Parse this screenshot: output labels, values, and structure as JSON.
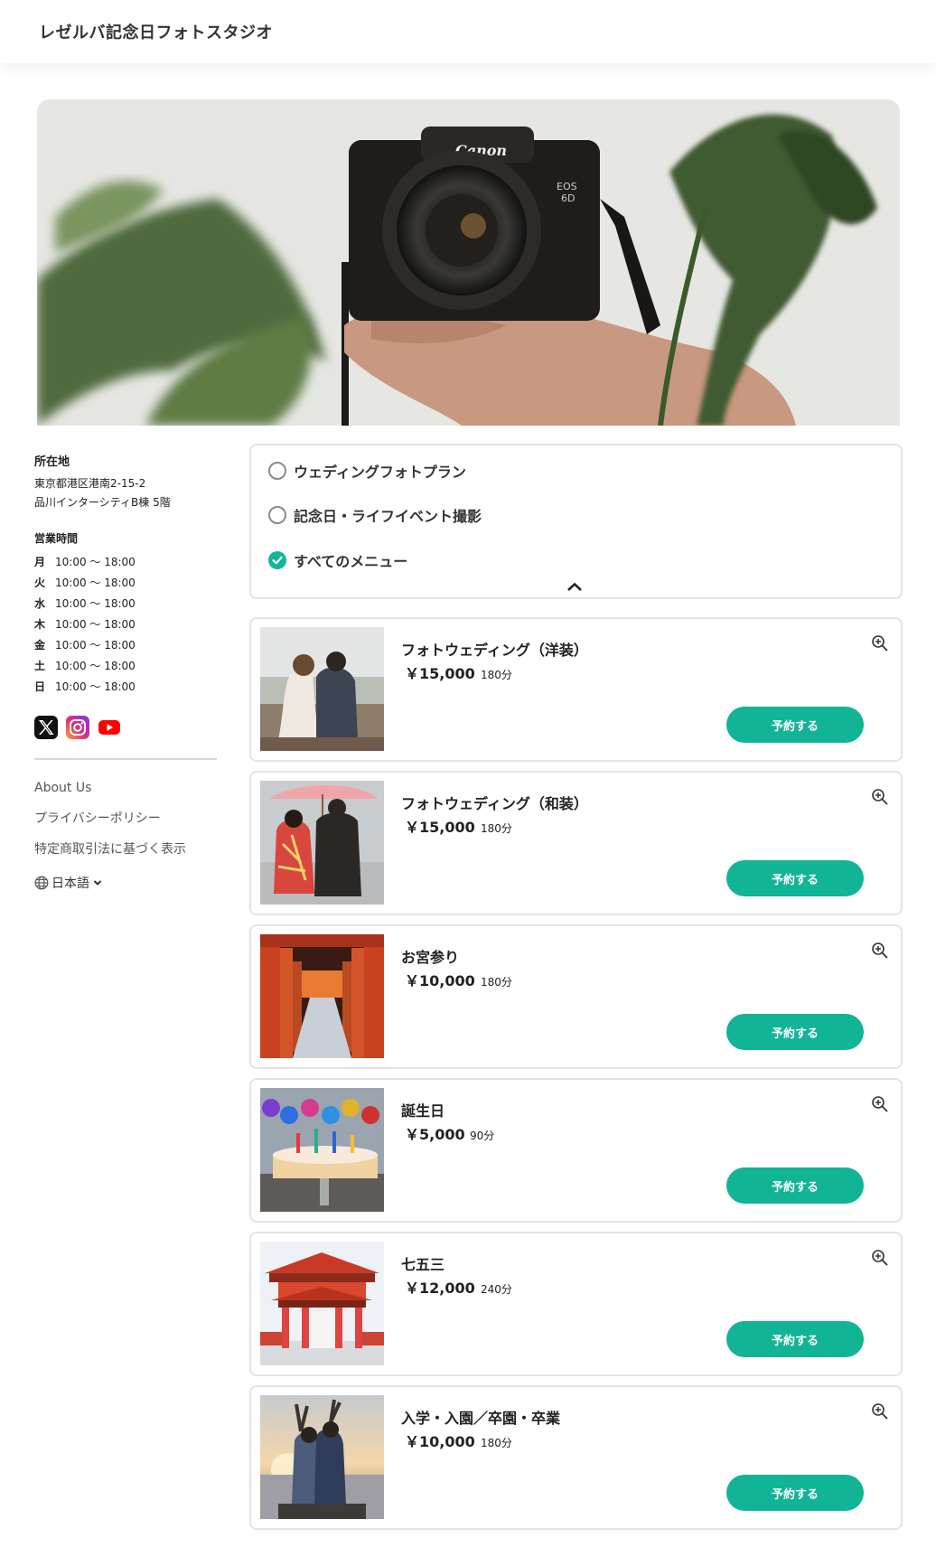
{
  "header": {
    "title": "レゼルバ記念日フォトスタジオ"
  },
  "sidebar": {
    "address_heading": "所在地",
    "address_line1": "東京都港区港南2-15-2",
    "address_line2": "品川インターシティB棟 5階",
    "hours_heading": "営業時間",
    "hours": [
      {
        "day": "月",
        "time": "10:00 ～ 18:00"
      },
      {
        "day": "火",
        "time": "10:00 ～ 18:00"
      },
      {
        "day": "水",
        "time": "10:00 ～ 18:00"
      },
      {
        "day": "木",
        "time": "10:00 ～ 18:00"
      },
      {
        "day": "金",
        "time": "10:00 ～ 18:00"
      },
      {
        "day": "土",
        "time": "10:00 ～ 18:00"
      },
      {
        "day": "日",
        "time": "10:00 ～ 18:00"
      }
    ],
    "social": [
      "x-icon",
      "instagram-icon",
      "youtube-icon"
    ],
    "links": [
      "About Us",
      "プライバシーポリシー",
      "特定商取引法に基づく表示"
    ],
    "language": "日本語"
  },
  "filter": {
    "options": [
      {
        "label": "ウェディングフォトプラン",
        "selected": false
      },
      {
        "label": "記念日・ライフイベント撮影",
        "selected": false
      },
      {
        "label": "すべてのメニュー",
        "selected": true
      }
    ]
  },
  "menu": [
    {
      "name": "フォトウェディング（洋装）",
      "price": "￥15,000",
      "duration": "180分",
      "button": "予約する"
    },
    {
      "name": "フォトウェディング（和装）",
      "price": "￥15,000",
      "duration": "180分",
      "button": "予約する"
    },
    {
      "name": "お宮参り",
      "price": "￥10,000",
      "duration": "180分",
      "button": "予約する"
    },
    {
      "name": "誕生日",
      "price": "￥5,000",
      "duration": "90分",
      "button": "予約する"
    },
    {
      "name": "七五三",
      "price": "￥12,000",
      "duration": "240分",
      "button": "予約する"
    },
    {
      "name": "入学・入園／卒園・卒業",
      "price": "￥10,000",
      "duration": "180分",
      "button": "予約する"
    }
  ],
  "colors": {
    "accent": "#12b496",
    "border": "#e4e4e4"
  }
}
